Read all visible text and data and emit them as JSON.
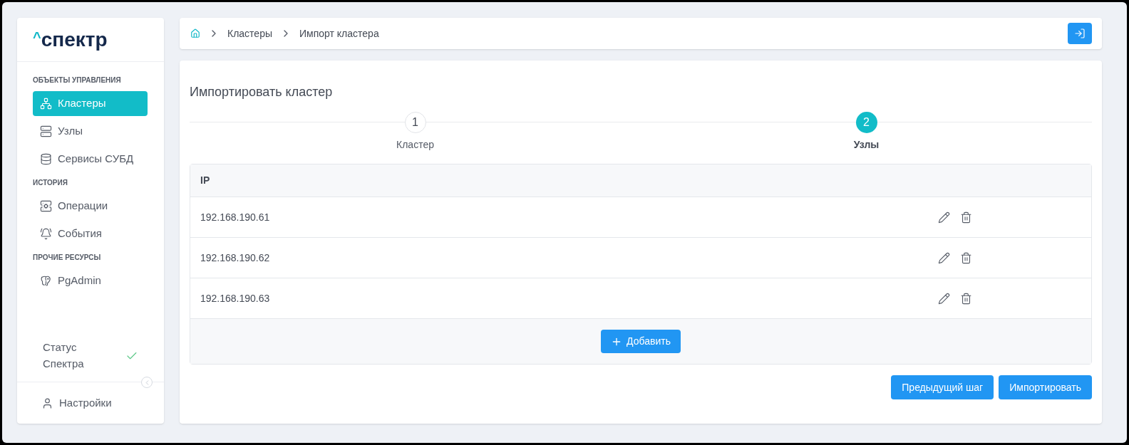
{
  "logo": {
    "mark": "^",
    "text": "спектр"
  },
  "sidebar": {
    "sections": [
      {
        "title": "ОБЪЕКТЫ УПРАВЛЕНИЯ",
        "items": [
          {
            "label": "Кластеры",
            "kind": "cluster",
            "selected": true
          },
          {
            "label": "Узлы",
            "kind": "server",
            "selected": false
          },
          {
            "label": "Сервисы СУБД",
            "kind": "database",
            "selected": false
          }
        ]
      },
      {
        "title": "ИСТОРИЯ",
        "items": [
          {
            "label": "Операции",
            "kind": "operations",
            "selected": false
          },
          {
            "label": "События",
            "kind": "bell",
            "selected": false
          }
        ]
      },
      {
        "title": "ПРОЧИЕ РЕСУРСЫ",
        "items": [
          {
            "label": "PgAdmin",
            "kind": "elephant",
            "selected": false
          }
        ]
      }
    ],
    "status": {
      "label": "Статус Спектра",
      "ok": true
    },
    "settings": {
      "label": "Настройки"
    }
  },
  "breadcrumbs": [
    "Кластеры",
    "Импорт кластера"
  ],
  "page_title": "Импортировать кластер",
  "steps": [
    {
      "number": "1",
      "label": "Кластер",
      "selected": false
    },
    {
      "number": "2",
      "label": "Узлы",
      "selected": true
    }
  ],
  "table": {
    "columns": [
      "IP"
    ],
    "rows": [
      {
        "ip": "192.168.190.61"
      },
      {
        "ip": "192.168.190.62"
      },
      {
        "ip": "192.168.190.63"
      }
    ],
    "add_button": "Добавить"
  },
  "buttons": [
    "Предыдущий шаг",
    "Импортировать"
  ]
}
